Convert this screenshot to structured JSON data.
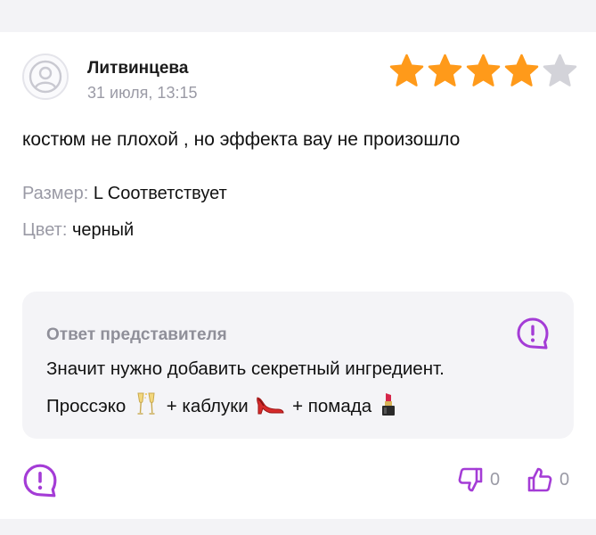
{
  "review": {
    "author": "Литвинцева",
    "date": "31 июля, 13:15",
    "rating": 4,
    "rating_max": 5,
    "text": "костюм не плохой , но эффекта вау не произошло",
    "attributes": [
      {
        "key": "Размер: ",
        "value": "L Соответствует"
      },
      {
        "key": "Цвет: ",
        "value": "черный"
      }
    ]
  },
  "answer": {
    "title": "Ответ представителя",
    "line1": "Значит нужно добавить секретный ингредиент.",
    "line2_part1": "Проссэко ",
    "line2_part2": " + каблуки ",
    "line2_part3": " + помада "
  },
  "votes": {
    "dislikes": "0",
    "likes": "0"
  },
  "colors": {
    "accent": "#a43cd6",
    "star_filled": "#ff9a1a",
    "star_empty": "#d3d3d9",
    "muted": "#9a9aa5",
    "answer_bg": "#f4f4f7"
  },
  "icons": {
    "avatar": "user-placeholder-icon",
    "answer": "exclamation-bubble-icon",
    "report": "exclamation-bubble-icon",
    "dislike": "thumbs-down-icon",
    "like": "thumbs-up-icon",
    "emoji1": "champagne-glasses-icon",
    "emoji2": "high-heel-icon",
    "emoji3": "lipstick-icon"
  }
}
